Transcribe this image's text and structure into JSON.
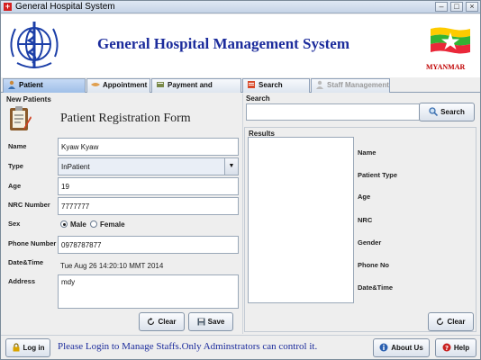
{
  "window": {
    "title": "General Hospital System"
  },
  "header": {
    "title": "General Hospital Management System",
    "country": "MYANMAR"
  },
  "tabs": [
    {
      "label": "Patient Registration"
    },
    {
      "label": "Appointment"
    },
    {
      "label": "Payment and Records"
    },
    {
      "label": "Search Record"
    },
    {
      "label": "Staff Management"
    }
  ],
  "form": {
    "section": "New Patients",
    "title": "Patient Registration Form",
    "name_label": "Name",
    "name_value": "Kyaw Kyaw",
    "type_label": "Type",
    "type_value": "InPatient",
    "age_label": "Age",
    "age_value": "19",
    "nrc_label": "NRC Number",
    "nrc_value": "7777777",
    "sex_label": "Sex",
    "male_label": "Male",
    "female_label": "Female",
    "phone_label": "Phone Number",
    "phone_value": "0978787877",
    "datetime_label": "Date&Time",
    "datetime_value": "Tue Aug 26 14:20:10 MMT 2014",
    "address_label": "Address",
    "address_value": "mdy",
    "clear_label": "Clear",
    "save_label": "Save"
  },
  "search": {
    "section": "Search",
    "button_label": "Search",
    "results_label": "Results",
    "fields": [
      "Name",
      "Patient Type",
      "Age",
      "NRC",
      "Gender",
      "Phone No",
      "Date&Time"
    ],
    "clear_label": "Clear"
  },
  "footer": {
    "login_label": "Log in",
    "notice": "Please Login to Manage Staffs.Only Adminstrators can control it.",
    "about_label": "About Us",
    "help_label": "Help"
  },
  "colors": {
    "title_blue": "#1c2c9c",
    "country_red": "#c00000",
    "tab_active": "#a8c6ee"
  }
}
